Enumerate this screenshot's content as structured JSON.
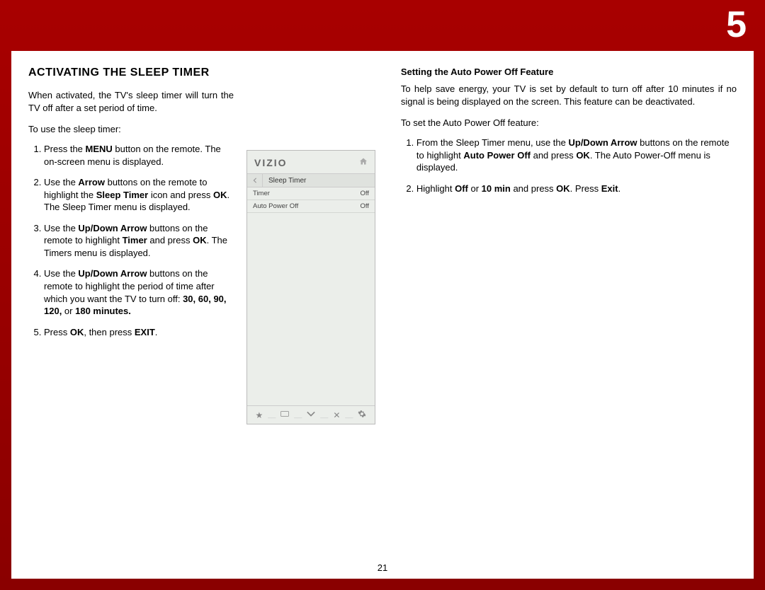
{
  "chapter_number": "5",
  "page_number": "21",
  "left": {
    "title": "Activating the Sleep Timer",
    "intro": "When activated, the TV's sleep timer will turn the TV off after a set period of time.",
    "lead_in": "To use the sleep timer:",
    "steps": {
      "s1_a": "Press the ",
      "s1_b": "MENU",
      "s1_c": " button on the remote. The on-screen menu is displayed.",
      "s2_a": "Use the ",
      "s2_b": "Arrow",
      "s2_c": " buttons on the remote to highlight the ",
      "s2_d": "Sleep Timer",
      "s2_e": " icon and press ",
      "s2_f": "OK",
      "s2_g": ". The Sleep Timer menu is displayed.",
      "s3_a": "Use the ",
      "s3_b": "Up/Down Arrow",
      "s3_c": " buttons on the remote to highlight ",
      "s3_d": "Timer",
      "s3_e": " and press ",
      "s3_f": "OK",
      "s3_g": ". The Timers menu is displayed.",
      "s4_a": "Use the ",
      "s4_b": "Up/Down Arrow",
      "s4_c": " buttons on the remote to highlight the period of time after which you want the TV to turn off: ",
      "s4_d": "30, 60, 90, 120,",
      "s4_e": " or ",
      "s4_f": "180 minutes.",
      "s5_a": "Press ",
      "s5_b": "OK",
      "s5_c": ", then press ",
      "s5_d": "EXIT",
      "s5_e": "."
    }
  },
  "osd": {
    "logo": "VIZIO",
    "breadcrumb": "Sleep Timer",
    "row1_label": "Timer",
    "row1_value": "Off",
    "row2_label": "Auto Power Off",
    "row2_value": "Off"
  },
  "right": {
    "subheading": "Setting the Auto Power Off Feature",
    "intro": "To help save energy, your TV is set by default to turn off after 10 minutes if no signal is being displayed on the screen. This feature can be deactivated.",
    "lead_in": "To set the Auto Power Off feature:",
    "steps": {
      "s1_a": "From the Sleep Timer menu, use the ",
      "s1_b": "Up/Down Arrow",
      "s1_c": " buttons on the remote to highlight ",
      "s1_d": "Auto Power Off",
      "s1_e": " and press ",
      "s1_f": "OK",
      "s1_g": ". The Auto Power-Off menu is displayed.",
      "s2_a": "Highlight ",
      "s2_b": "Off",
      "s2_c": " or ",
      "s2_d": "10 min",
      "s2_e": " and press ",
      "s2_f": "OK",
      "s2_g": ". Press ",
      "s2_h": "Exit",
      "s2_i": "."
    }
  }
}
